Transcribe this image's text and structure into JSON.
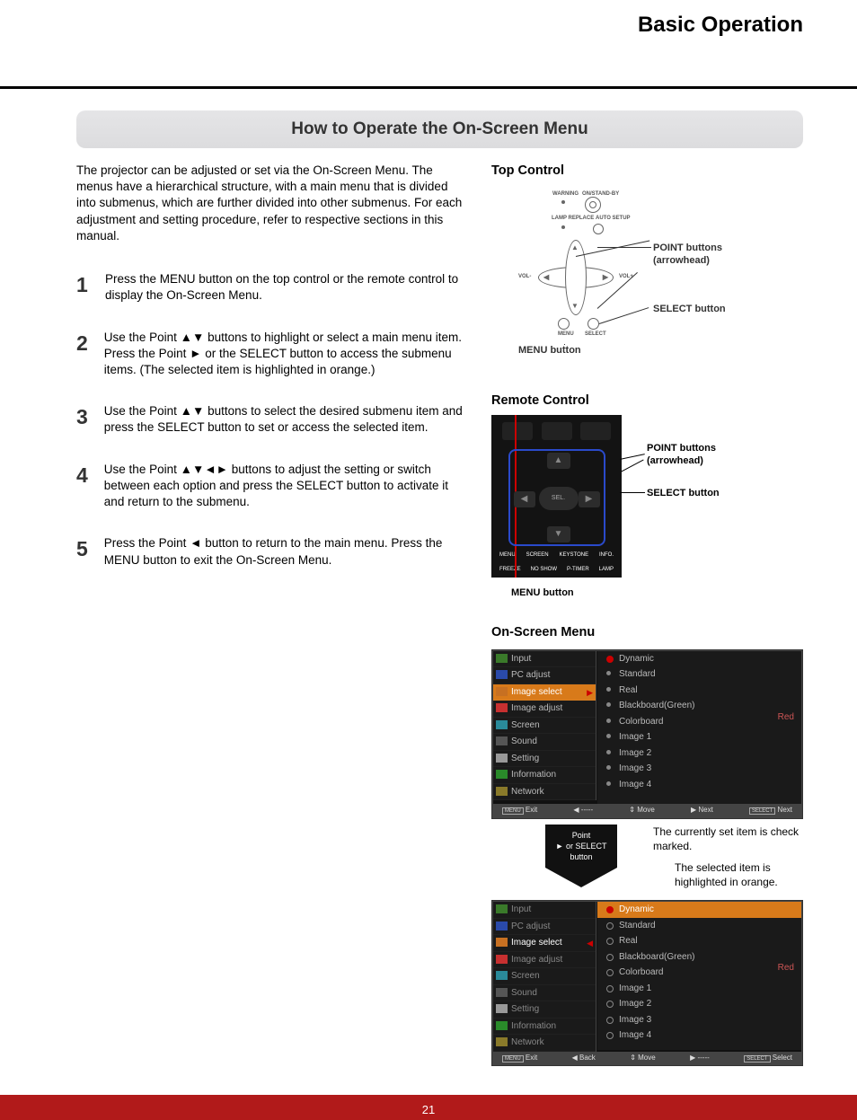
{
  "header": {
    "section_title": "Basic Operation"
  },
  "title": "How to Operate the On-Screen Menu",
  "intro": "The projector can be adjusted or set via the On-Screen Menu. The menus have a hierarchical structure, with a main menu that is divided into submenus, which are further divided into other submenus. For each adjustment and setting procedure, refer to respective sections in this manual.",
  "steps": [
    {
      "num": "1",
      "text": "Press the MENU button on the top control or the remote control to display the On-Screen Menu."
    },
    {
      "num": "2",
      "text": "Use the Point ▲▼ buttons to highlight or select a main menu item. Press the Point ► or the SELECT button to access the submenu items. (The selected item is highlighted in orange.)"
    },
    {
      "num": "3",
      "text": "Use the Point ▲▼ buttons to select the desired submenu item and press the SELECT button to set or access the selected item."
    },
    {
      "num": "4",
      "text": "Use the Point ▲▼◄► buttons to adjust the setting or switch between each option and press the SELECT button to activate it and return to the submenu."
    },
    {
      "num": "5",
      "text": "Press the Point ◄ button to return to the main menu. Press the MENU button to exit the On-Screen Menu."
    }
  ],
  "top_control": {
    "heading": "Top Control",
    "labels": {
      "warning": "WARNING",
      "onstandby": "ON/STAND-BY",
      "lamp_replace": "LAMP REPLACE",
      "auto_setup": "AUTO SETUP",
      "vol_minus": "VOL-",
      "vol_plus": "VOL+",
      "menu": "MENU",
      "select": "SELECT"
    },
    "callouts": {
      "point_buttons": "POINT buttons (arrowhead)",
      "select_button": "SELECT button",
      "menu_button": "MENU button"
    }
  },
  "remote_control": {
    "heading": "Remote Control",
    "sel_label": "SEL.",
    "row_labels": [
      "MENU",
      "SCREEN",
      "KEYSTONE",
      "INFO."
    ],
    "row_labels2": [
      "FREEZE",
      "NO SHOW",
      "P-TIMER",
      "LAMP"
    ],
    "callouts": {
      "point_buttons": "POINT buttons (arrowhead)",
      "select_button": "SELECT button",
      "menu_button": "MENU button"
    }
  },
  "osd": {
    "heading": "On-Screen Menu",
    "left_items": [
      "Input",
      "PC adjust",
      "Image select",
      "Image adjust",
      "Screen",
      "Sound",
      "Setting",
      "Information",
      "Network"
    ],
    "right_items": [
      "Dynamic",
      "Standard",
      "Real",
      "Blackboard(Green)",
      "Colorboard",
      "Image 1",
      "Image 2",
      "Image 3",
      "Image 4"
    ],
    "colorboard_value": "Red",
    "statusbar1": {
      "exit": "Exit",
      "back": "-----",
      "move": "Move",
      "next": "Next",
      "select": "Next",
      "menu_key": "MENU",
      "select_key": "SELECT"
    },
    "point_box": {
      "line1": "Point",
      "line2": "► or SELECT",
      "line3": "button"
    },
    "expl1": "The currently set item is check marked.",
    "expl2": "The selected item is highlighted in orange.",
    "statusbar2": {
      "exit": "Exit",
      "back": "Back",
      "move": "Move",
      "next": "-----",
      "select": "Select",
      "menu_key": "MENU",
      "select_key": "SELECT"
    }
  },
  "page_number": "21"
}
